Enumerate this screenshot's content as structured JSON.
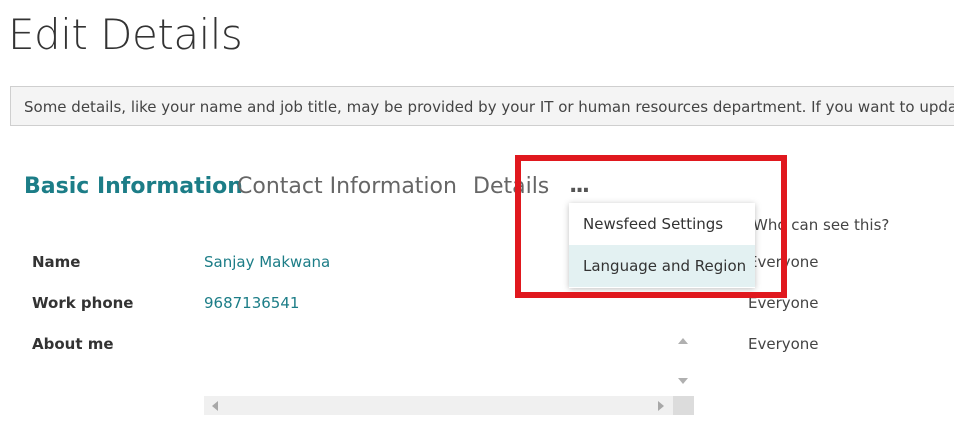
{
  "page": {
    "title": "Edit Details",
    "notice": "Some details, like your name and job title, may be provided by your IT or human resources department. If you want to update those details, contact your administrator."
  },
  "tabs": {
    "basic": "Basic Information",
    "contact": "Contact Information",
    "details": "Details",
    "more": "..."
  },
  "visibility_header": "Who can see this?",
  "fields": [
    {
      "label": "Name",
      "value": "Sanjay Makwana",
      "visibility": "Everyone"
    },
    {
      "label": "Work phone",
      "value": "9687136541",
      "visibility": "Everyone"
    },
    {
      "label": "About me",
      "value": "",
      "visibility": "Everyone"
    }
  ],
  "more_menu": {
    "items": [
      {
        "label": "Newsfeed Settings"
      },
      {
        "label": "Language and Region"
      }
    ],
    "selected": "Language and Region"
  },
  "colors": {
    "accent": "#1c7d87",
    "highlight_box": "#e0181e",
    "menu_selected": "#e3f1f2"
  }
}
